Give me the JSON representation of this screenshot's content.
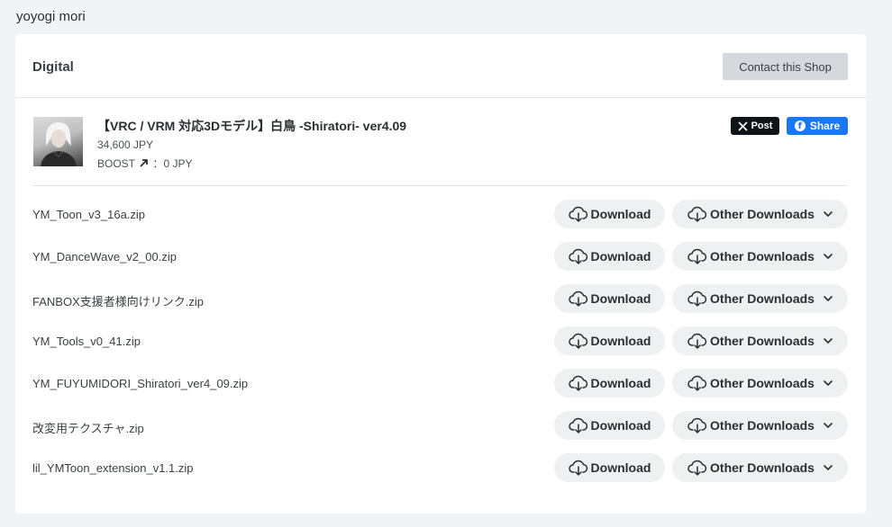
{
  "shop": {
    "name": "yoyogi mori"
  },
  "section": {
    "title": "Digital",
    "contact_label": "Contact this Shop"
  },
  "product": {
    "title": "【VRC / VRM 対応3Dモデル】白鳥 -Shiratori- ver4.09",
    "price": "34,600 JPY",
    "boost_label": "BOOST",
    "boost_value": "：0 JPY"
  },
  "share": {
    "x_label": "Post",
    "fb_label": "Share",
    "fb_glyph": "f"
  },
  "actions": {
    "download_label": "Download",
    "other_label": "Other Downloads"
  },
  "files": [
    {
      "name": "YM_Toon_v3_16a.zip"
    },
    {
      "name": "YM_DanceWave_v2_00.zip"
    },
    {
      "name": "FANBOX支援者様向けリンク.zip"
    },
    {
      "name": "YM_Tools_v0_41.zip"
    },
    {
      "name": "YM_FUYUMIDORI_Shiratori_ver4_09.zip"
    },
    {
      "name": "改変用テクスチャ.zip"
    },
    {
      "name": "lil_YMToon_extension_v1.1.zip"
    }
  ],
  "icons": {
    "download": "cloud-download-icon",
    "dropdown": "chevron-down-icon",
    "boost": "arrow-up-right-icon",
    "x": "x-logo-icon",
    "facebook": "facebook-icon"
  },
  "colors": {
    "page_bg": "#f1f4f7",
    "card_bg": "#ffffff",
    "button_bg": "#eef0f2",
    "contact_bg": "#d5d8dc",
    "x_bg": "#0f1419",
    "facebook_blue": "#1877f2"
  }
}
